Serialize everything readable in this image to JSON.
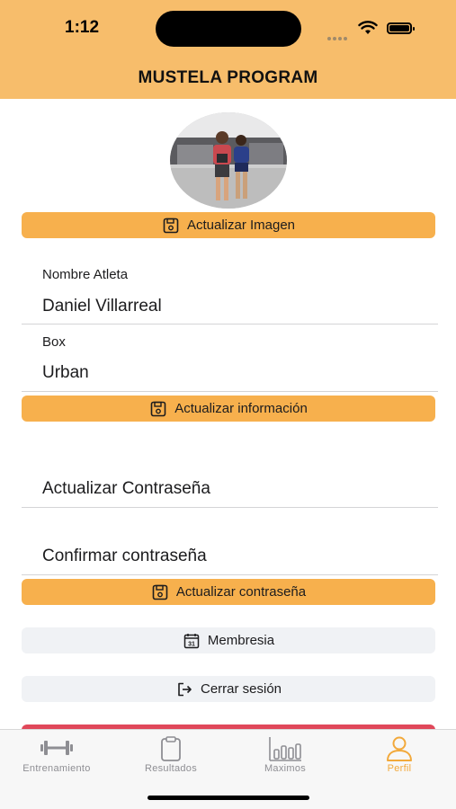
{
  "status_bar": {
    "time": "1:12"
  },
  "header": {
    "title": "MUSTELA PROGRAM"
  },
  "profile": {
    "update_image_label": "Actualizar Imagen",
    "athlete_name_label": "Nombre Atleta",
    "athlete_name_value": "Daniel Villarreal",
    "box_label": "Box",
    "box_value": "Urban",
    "update_info_label": "Actualizar información",
    "password_placeholder": "Actualizar Contraseña",
    "confirm_password_placeholder": "Confirmar contraseña",
    "update_password_label": "Actualizar contraseña",
    "membership_label": "Membresia",
    "logout_label": "Cerrar sesión"
  },
  "tabbar": {
    "items": [
      {
        "label": "Entrenamiento",
        "icon": "dumbbell-icon",
        "active": false
      },
      {
        "label": "Resultados",
        "icon": "clipboard-icon",
        "active": false
      },
      {
        "label": "Maximos",
        "icon": "bar-chart-icon",
        "active": false
      },
      {
        "label": "Perfil",
        "icon": "person-icon",
        "active": true
      }
    ]
  },
  "colors": {
    "header": "#f7bd6b",
    "primary_button": "#f7b04d",
    "secondary_button": "#f0f2f5",
    "active_tab": "#f2a93b",
    "danger_strip": "#e0485a"
  }
}
